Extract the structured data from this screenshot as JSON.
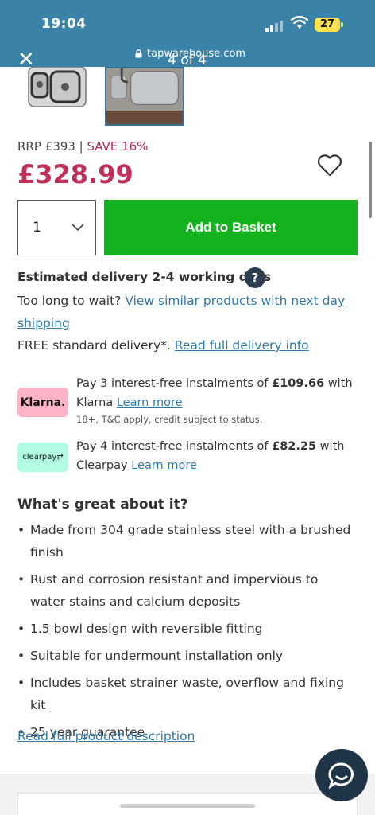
{
  "status_bar": {
    "time": "19:04",
    "battery": "27"
  },
  "browser": {
    "url": "tapwarehouse.com",
    "image_counter": "4 of 4"
  },
  "price": {
    "rrp": "RRP £393",
    "separator": " | ",
    "save": "SAVE 16%",
    "current": "£328.99"
  },
  "basket": {
    "quantity": "1",
    "add_label": "Add to Basket"
  },
  "delivery": {
    "title": "Estimated delivery 2-4 working days",
    "help": "?",
    "too_long_text": "Too long to wait? ",
    "similar_link_1": "View similar products with next day",
    "similar_link_2": "shipping",
    "free_bold": "FREE",
    "free_text": " standard delivery*. ",
    "delivery_link": "Read full delivery info"
  },
  "klarna": {
    "badge": "Klarna.",
    "line1_pre": "Pay 3 interest-free instalments of ",
    "amount": "£109.66",
    "line1_post": " with",
    "line2_pre": "Klarna ",
    "learn_more": "Learn more",
    "small": "18+, T&C apply, credit subject to status."
  },
  "clearpay": {
    "badge": "clearpay",
    "line1_pre": "Pay 4 interest-free instalments of ",
    "amount": "£82.25",
    "line1_post": " with",
    "line2_pre": "Clearpay ",
    "learn_more": "Learn more"
  },
  "features": {
    "title": "What's great about it?",
    "items": [
      "Made from 304 grade stainless steel with a brushed finish",
      "Rust and corrosion resistant and impervious to water stains and calcium deposits",
      "1.5 bowl design with reversible fitting",
      "Suitable for undermount installation only",
      "Includes basket strainer waste, overflow and fixing kit",
      "25 year guarantee"
    ],
    "read_more": "Read full product description"
  },
  "colors": {
    "header": "#3a82a6",
    "price": "#c12f5a",
    "button": "#13b21e",
    "link": "#2f7ba8"
  }
}
